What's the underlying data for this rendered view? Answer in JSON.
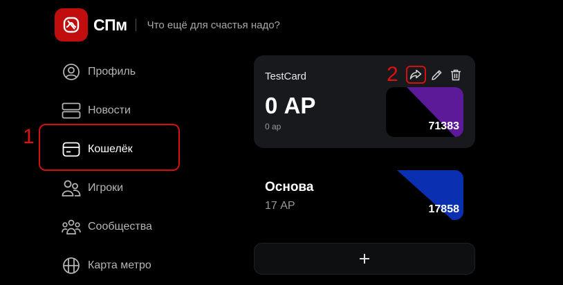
{
  "app": {
    "title": "СПм",
    "tagline": "Что ещё для счастья надо?",
    "logo_color": "#c00d0d"
  },
  "sidebar": {
    "items": [
      {
        "label": "Профиль",
        "icon": "user-circle-icon"
      },
      {
        "label": "Новости",
        "icon": "news-icon"
      },
      {
        "label": "Кошелёк",
        "icon": "wallet-icon",
        "active": true
      },
      {
        "label": "Игроки",
        "icon": "users-icon"
      },
      {
        "label": "Сообщества",
        "icon": "community-icon"
      },
      {
        "label": "Карта метро",
        "icon": "metro-map-icon"
      }
    ]
  },
  "annotations": {
    "marker_1": "1",
    "marker_2": "2",
    "highlight_color": "#d31111"
  },
  "wallet": {
    "cards": [
      {
        "name": "TestCard",
        "amount": "0 АР",
        "sub": "0 ар",
        "number": "71383",
        "color": "#5c1a99",
        "actions": [
          "share-icon",
          "edit-icon",
          "delete-icon"
        ]
      },
      {
        "name": "Основа",
        "amount": "17 АР",
        "number": "17858",
        "color": "#0a2fb0"
      }
    ],
    "add_button": "+"
  }
}
